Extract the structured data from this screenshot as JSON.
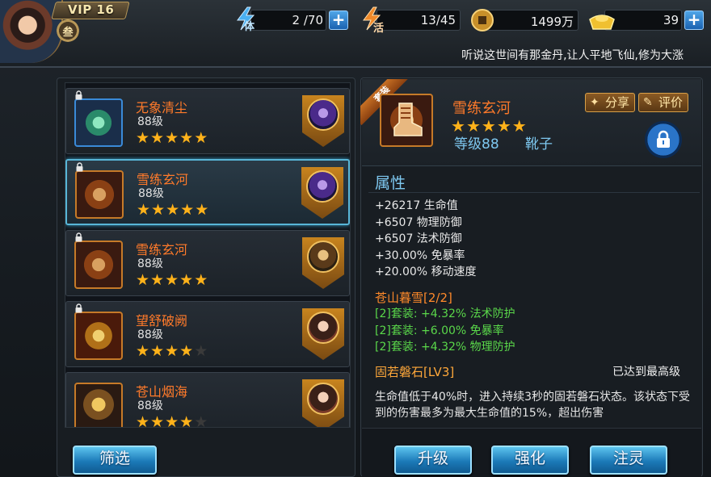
{
  "player": {
    "vip_label": "VIP 16",
    "rank_badge": "叁"
  },
  "resources": {
    "stamina": {
      "icon": "stamina-icon",
      "icon_char": "体",
      "value": "2 /70"
    },
    "energy": {
      "icon": "energy-icon",
      "icon_char": "活",
      "value": "13/45"
    },
    "coins": {
      "icon": "coin-icon",
      "value": "1499万"
    },
    "gold": {
      "icon": "gold-ingot-icon",
      "value": "39"
    },
    "plus_label": "+"
  },
  "ticker": {
    "text": "听说这世间有那金丹,让人平地飞仙,修为大涨"
  },
  "equipment_list": {
    "items": [
      {
        "name": "无象清尘",
        "level": "88级",
        "stars": 5,
        "hero_face": "purple",
        "icon_style": "green",
        "locked": true
      },
      {
        "name": "雪练玄河",
        "level": "88级",
        "stars": 5,
        "hero_face": "purple",
        "icon_style": "boot",
        "locked": true,
        "selected": true
      },
      {
        "name": "雪练玄河",
        "level": "88级",
        "stars": 5,
        "hero_face": "warrior",
        "icon_style": "boot",
        "locked": true
      },
      {
        "name": "望舒破阙",
        "level": "88级",
        "stars": 4,
        "hero_face": "lady",
        "icon_style": "gold",
        "locked": true
      },
      {
        "name": "苍山烟海",
        "level": "88级",
        "stars": 4,
        "hero_face": "lady",
        "icon_style": "helm",
        "locked": false
      }
    ],
    "filter_button": "筛选"
  },
  "detail": {
    "ribbon": "套装",
    "name": "雪练玄河",
    "stars": 5,
    "level_text": "等级88",
    "type_text": "靴子",
    "share_button": "分享",
    "review_button": "评价",
    "attributes_title": "属性",
    "attributes": [
      "+26217 生命值",
      "+6507 物理防御",
      "+6507 法术防御",
      "+30.00% 免暴率",
      "+20.00% 移动速度"
    ],
    "set_title": "苍山暮雪[2/2]",
    "set_bonuses": [
      "[2]套装: +4.32% 法术防护",
      "[2]套装: +6.00% 免暴率",
      "[2]套装: +4.32% 物理防护"
    ],
    "skill_title": "固若磐石[LV3]",
    "skill_status": "已达到最高级",
    "skill_desc": "生命值低于40%时，进入持续3秒的固若磐石状态。该状态下受到的伤害最多为最大生命值的15%，超出伤害"
  },
  "actions": {
    "upgrade": "升级",
    "enhance": "强化",
    "infuse": "注灵"
  }
}
